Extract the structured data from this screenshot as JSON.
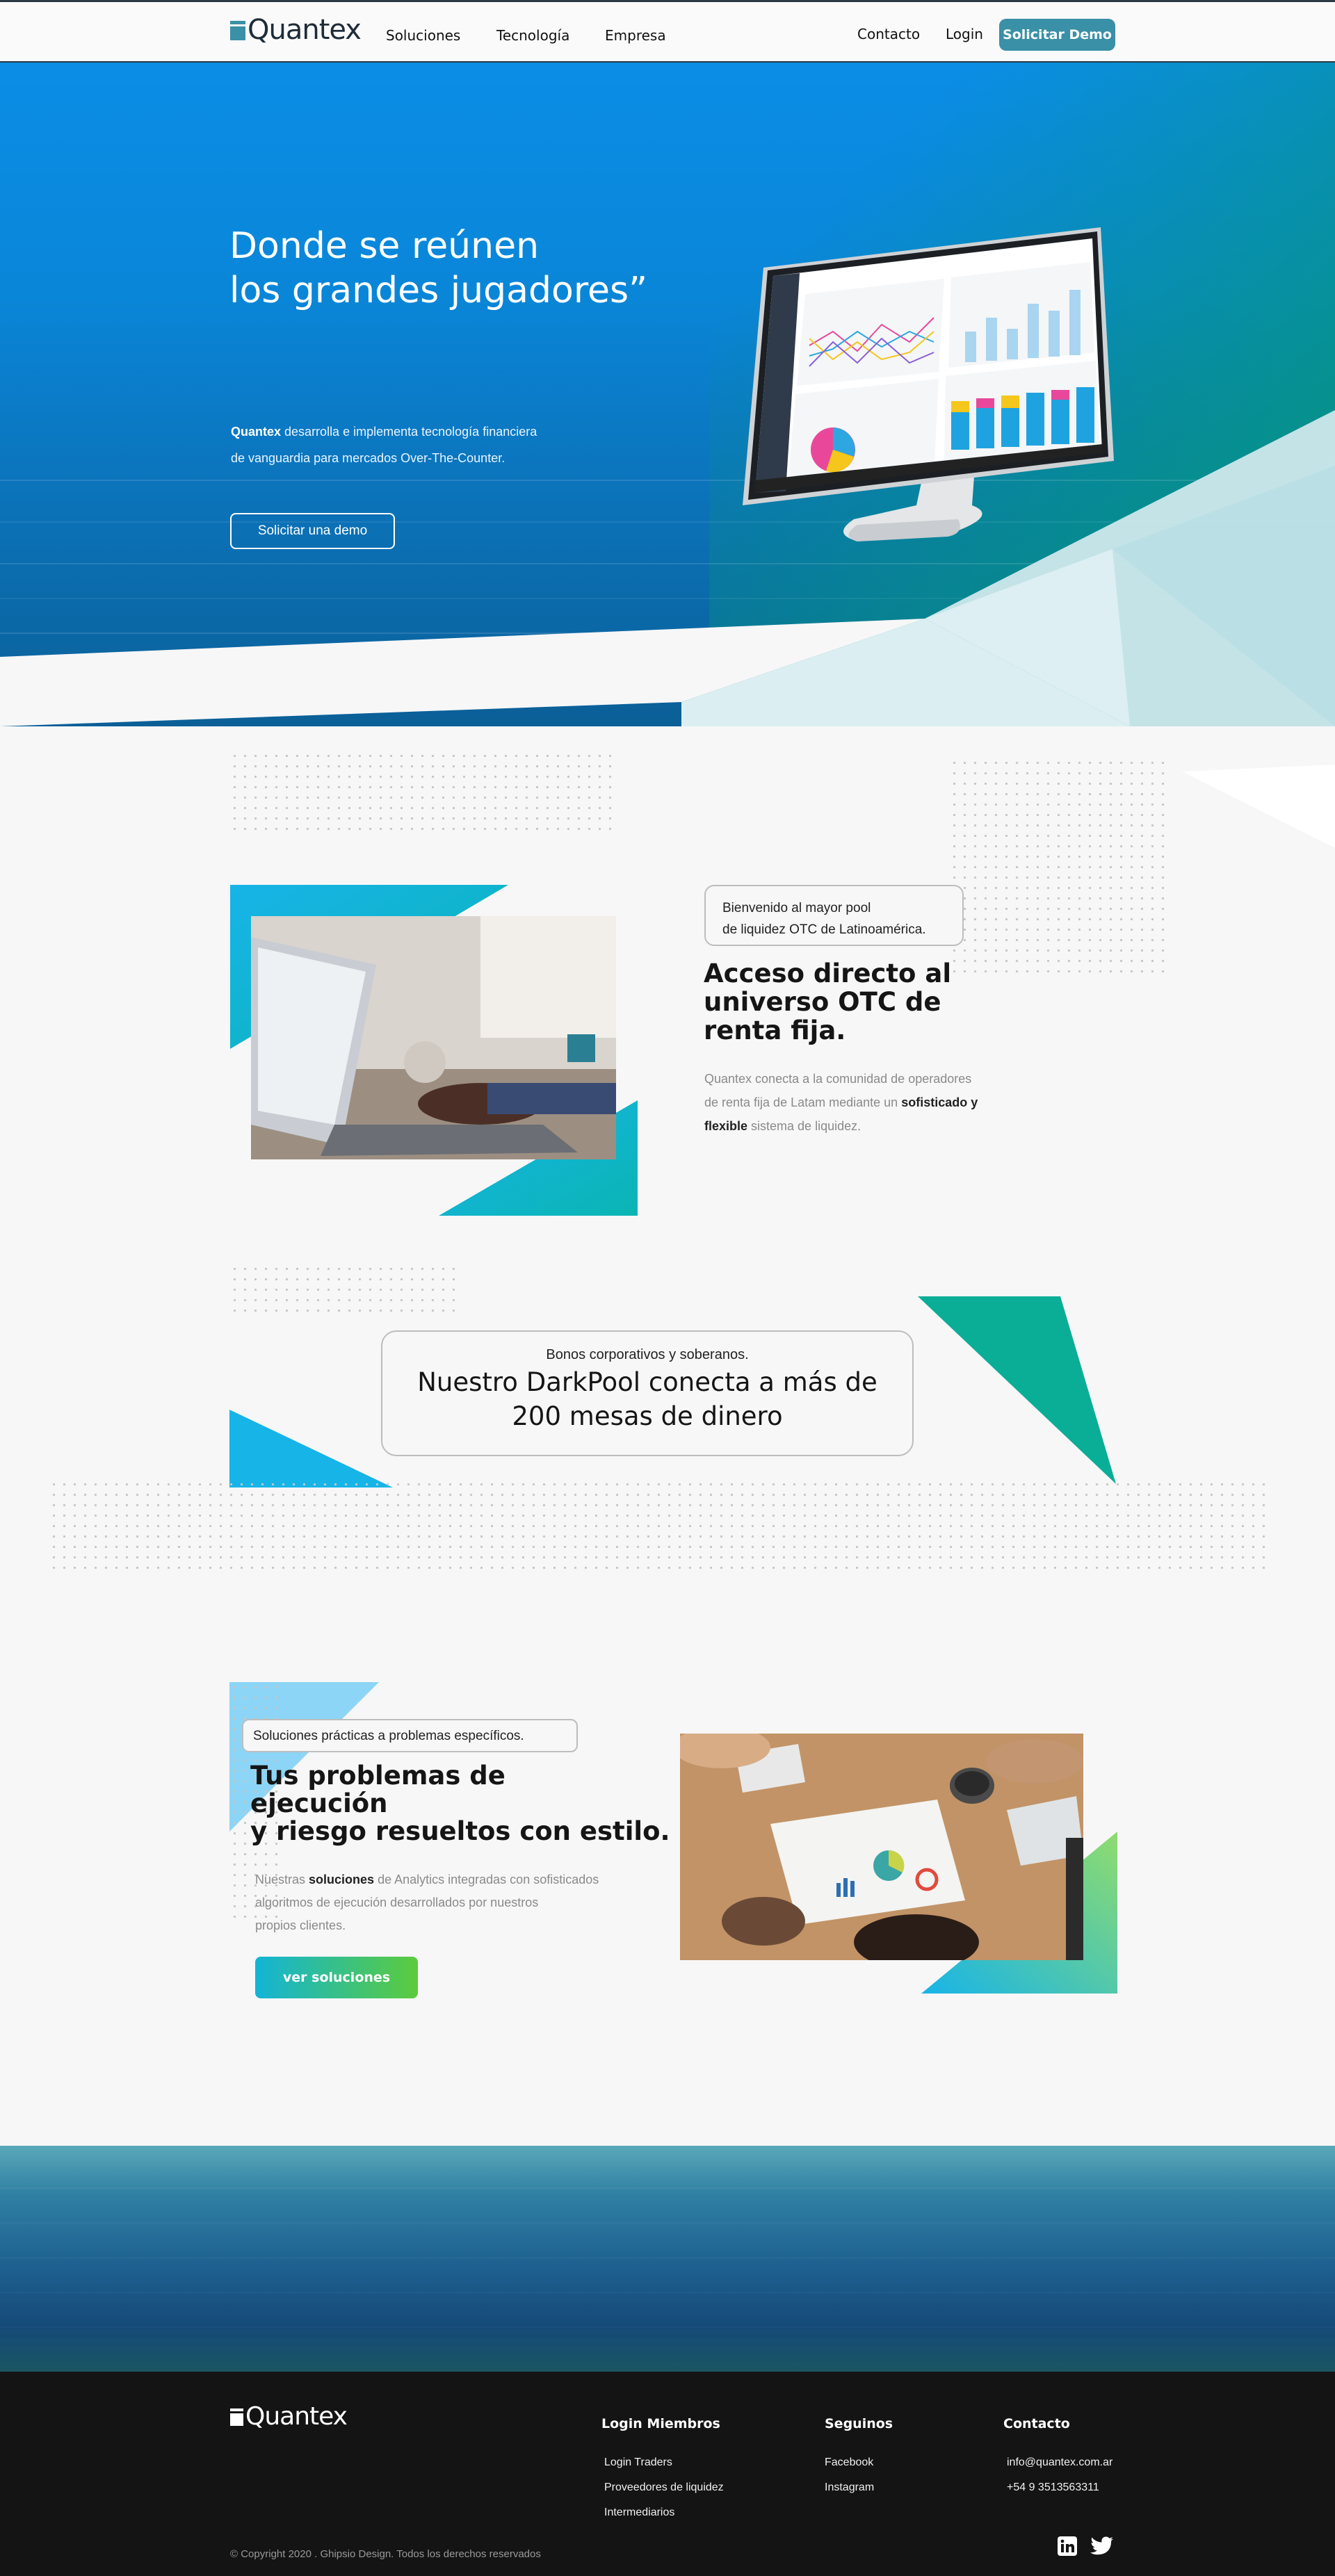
{
  "nav": {
    "logo": "Quantex",
    "links": [
      "Soluciones",
      "Tecnología",
      "Empresa"
    ],
    "contact": "Contacto",
    "login": "Login",
    "cta": "Solicitar Demo"
  },
  "hero": {
    "title_line1": "Donde se reúnen",
    "title_line2": "los grandes jugadores”",
    "desc_brand": "Quantex",
    "desc_rest": " desarrolla e implementa tecnología financiera",
    "desc_line2": "de vanguardia para mercados Over-The-Counter.",
    "cta": "Solicitar una demo"
  },
  "section_otc": {
    "badge_line1": "Bienvenido al mayor pool",
    "badge_line2": "de liquidez OTC de Latinoamérica.",
    "title_line1": "Acceso directo al",
    "title_line2": "universo OTC de",
    "title_line3": "renta fija.",
    "p_line1": "Quantex conecta a la comunidad de operadores",
    "p_line2a": "de renta fija de Latam mediante un ",
    "p_line2b": "sofisticado y",
    "p_line3a": "flexible",
    "p_line3b": " sistema de liquidez."
  },
  "section_darkpool": {
    "kicker": "Bonos corporativos y soberanos.",
    "title_line1": "Nuestro DarkPool conecta a más de",
    "title_line2": "200 mesas de dinero"
  },
  "section_solutions": {
    "badge": "Soluciones prácticas a problemas específicos.",
    "title_line1": "Tus problemas de",
    "title_line2": "ejecución",
    "title_line3": "y riesgo resueltos con estilo.",
    "p_line1a": "Nuestras ",
    "p_line1b": "soluciones",
    "p_line1c": " de Analytics integradas con sofisticados",
    "p_line2": " algoritmos de ejecución desarrollados por nuestros",
    "p_line3": "propios clientes.",
    "cta": "ver soluciones"
  },
  "footer": {
    "logo": "Quantex",
    "col1_title": "Login Miembros",
    "col1_links": [
      "Login Traders",
      "Proveedores de liquidez",
      "Intermediarios"
    ],
    "col2_title": "Seguinos",
    "col2_links": [
      "Facebook",
      "Instagram"
    ],
    "col3_title": "Contacto",
    "col3_links": [
      "info@quantex.com.ar",
      "+54 9 3513563311"
    ],
    "copyright": "© Copyright 2020 . Ghipsio Design. Todos los derechos reservados",
    "icons": [
      "linkedin-icon",
      "twitter-icon"
    ]
  },
  "colors": {
    "accent": "#3a90a6",
    "hero_blue": "#0b8de6",
    "teal": "#10ad96",
    "cyan": "#16b6e6",
    "footer_bg": "#141414"
  }
}
